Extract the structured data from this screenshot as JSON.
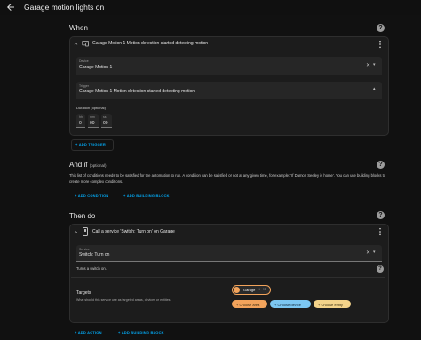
{
  "header": {
    "title": "Garage motion lights on"
  },
  "when": {
    "heading": "When",
    "trigger_title": "Garage Motion 1 Motion detection started detecting motion",
    "device_label": "Device",
    "device_value": "Garage Motion 1",
    "trigger_label": "Trigger",
    "trigger_value": "Garage Motion 1 Motion detection started detecting motion",
    "duration_label": "Duration (optional)",
    "hh_label": "hh",
    "hh_value": "0",
    "mm_label": "mm",
    "mm_value": "00",
    "ss_label": "ss",
    "ss_value": "00",
    "add_trigger": "ADD TRIGGER"
  },
  "andif": {
    "heading": "And if",
    "optional": "(optional)",
    "description": "This list of conditions needs to be satisfied for the automation to run. A condition can be satisfied or not at any given time, for example: 'If Damon Seeley is home'. You can use building blocks to create more complex conditions.",
    "add_condition": "ADD CONDITION",
    "add_building_block": "ADD BUILDING BLOCK"
  },
  "thendo": {
    "heading": "Then do",
    "action_title": "Call a service 'Switch: Turn on' on Garage",
    "service_label": "Service",
    "service_value": "Switch: Turn on",
    "service_desc": "Turns a switch on.",
    "targets_label": "Targets",
    "targets_desc": "What should this service use as targeted areas, devices or entities.",
    "target_chip": "Garage",
    "choose_area": "Choose area",
    "choose_device": "Choose device",
    "choose_entity": "Choose entity",
    "add_action": "ADD ACTION",
    "add_building_block": "ADD BUILDING BLOCK"
  },
  "colors": {
    "accent": "#03a9f4",
    "area_chip": "#f2a35b",
    "device_chip": "#7cc7f2",
    "entity_chip": "#f3d38a"
  }
}
